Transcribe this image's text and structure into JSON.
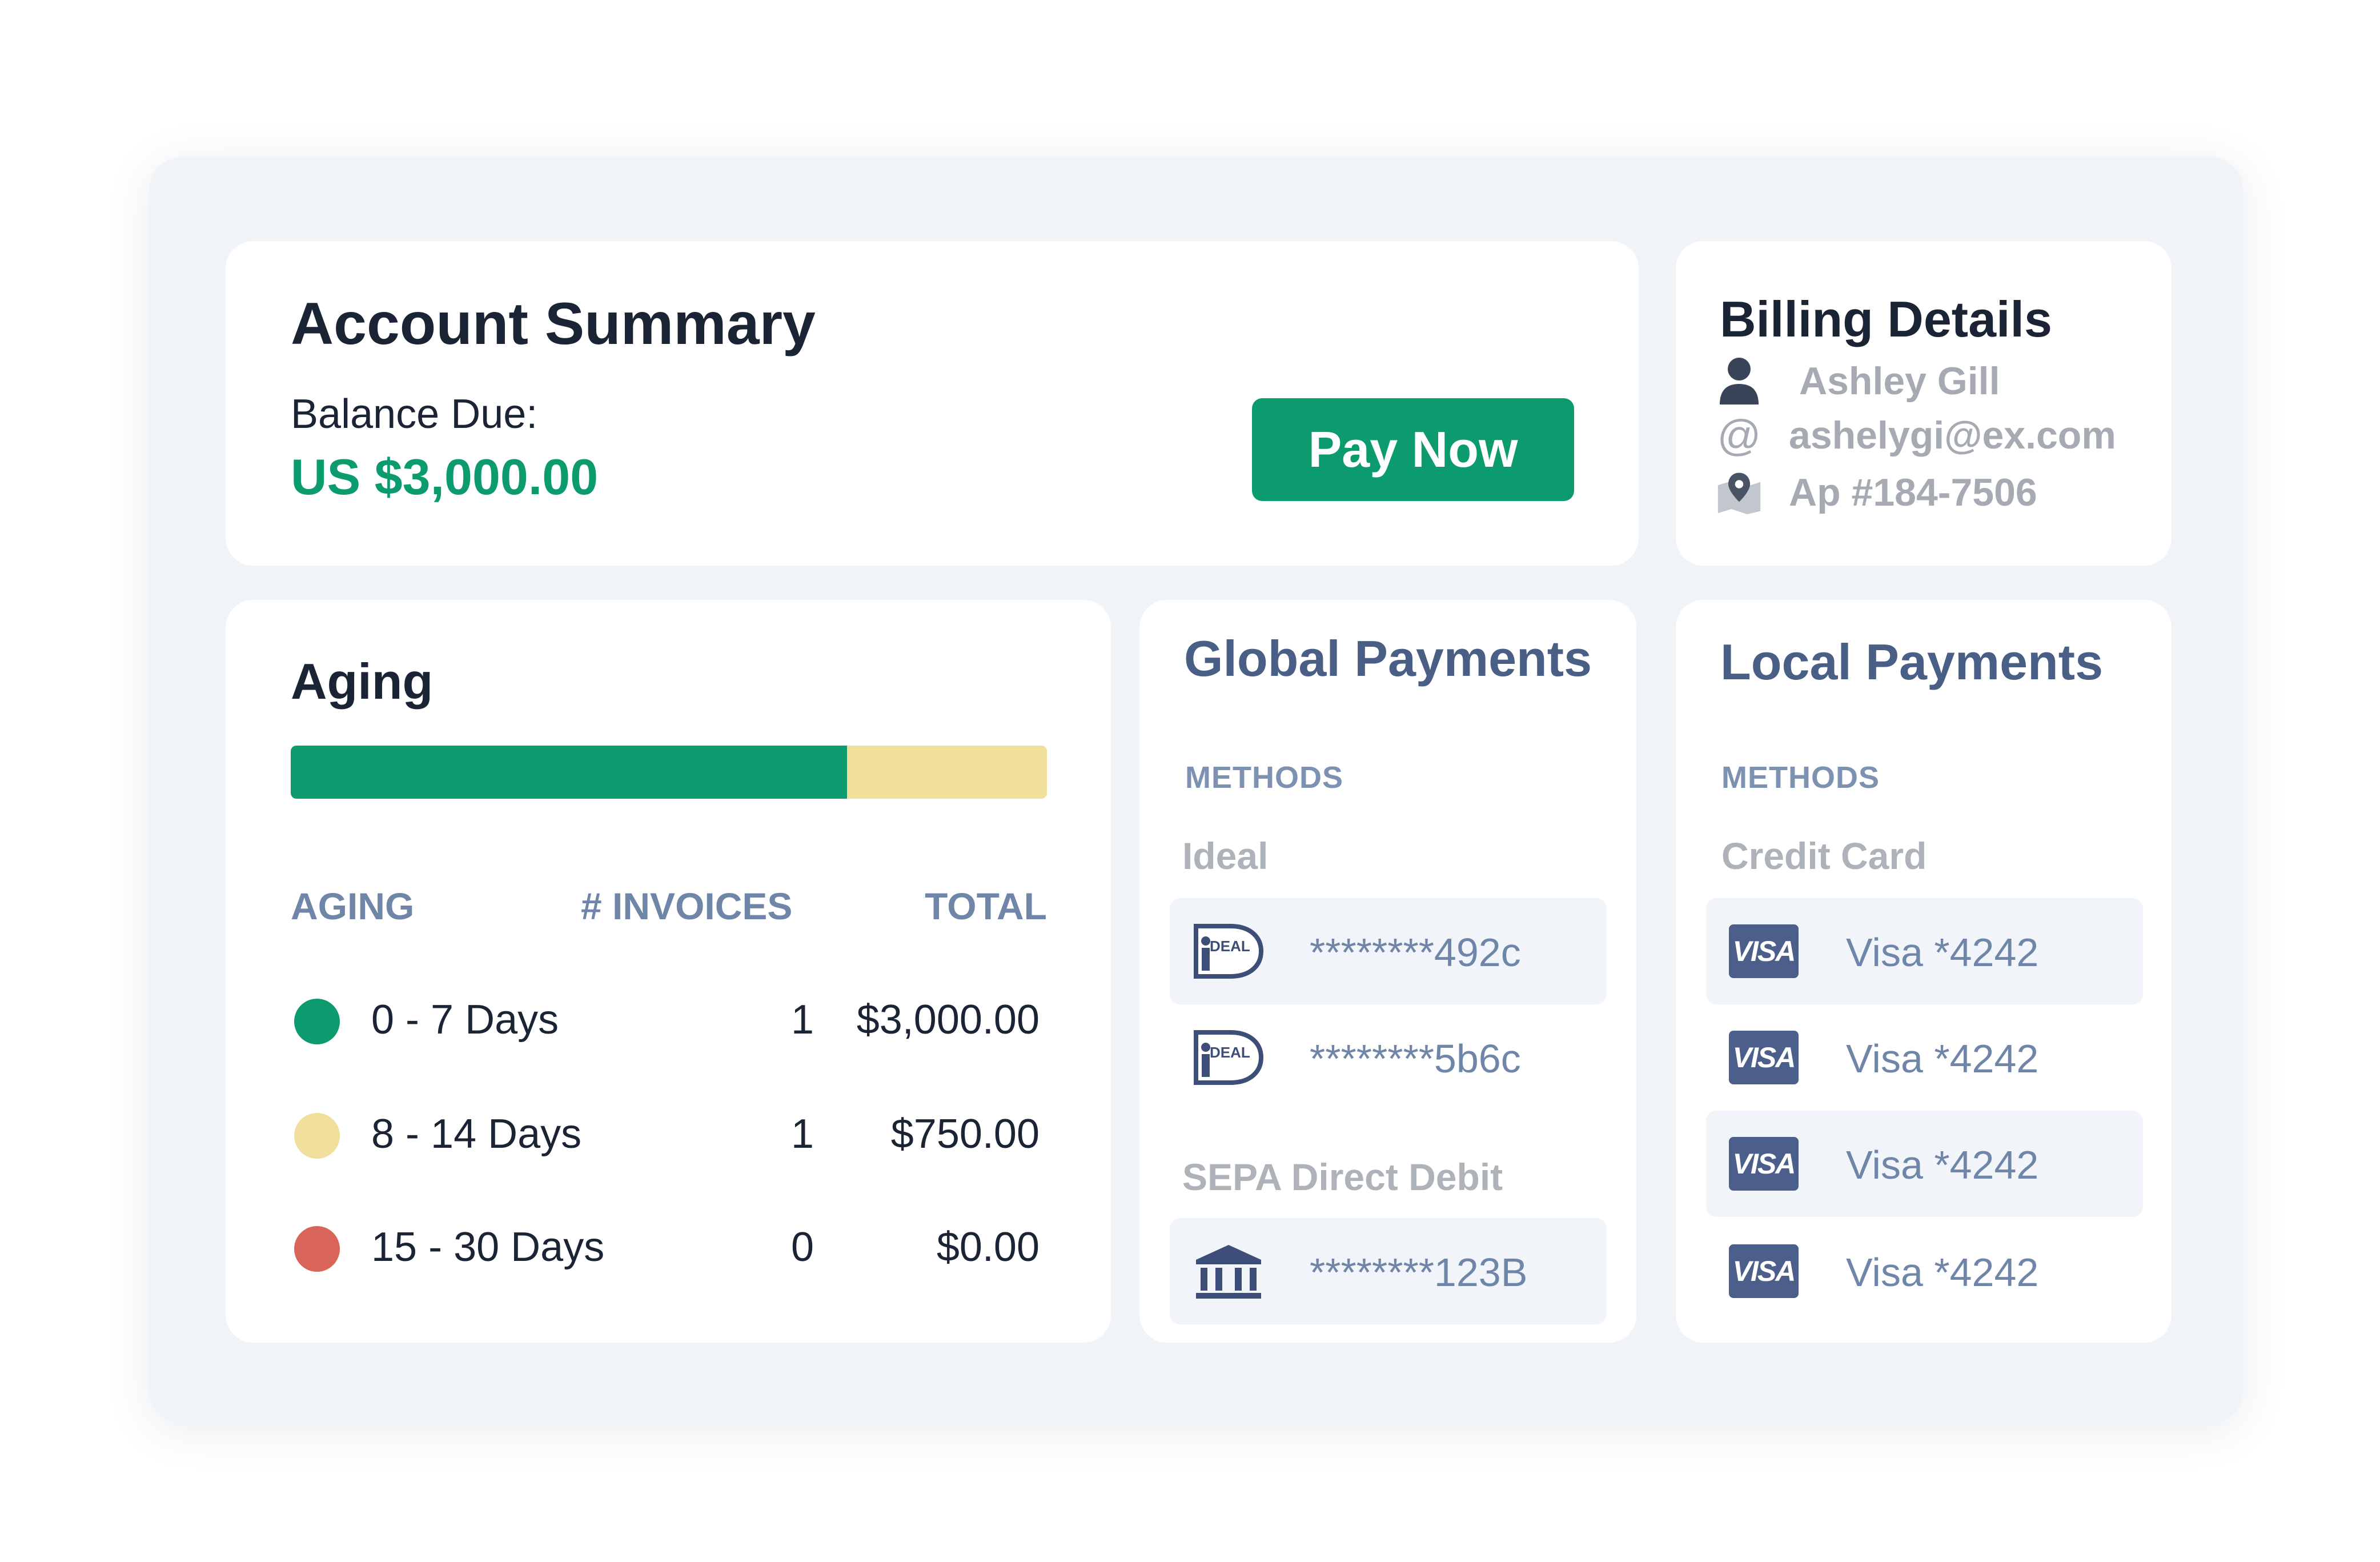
{
  "account_summary": {
    "title": "Account Summary",
    "balance_label": "Balance Due:",
    "balance_value": "US $3,000.00",
    "pay_button": "Pay Now"
  },
  "billing": {
    "title": "Billing Details",
    "name": "Ashley Gill",
    "email": "ashelygi@ex.com",
    "address": "Ap #184-7506",
    "icons": [
      "user-icon",
      "at-icon",
      "map-pin-icon"
    ]
  },
  "aging": {
    "title": "Aging",
    "bar": {
      "green_fraction": 0.736,
      "yellow_fraction": 0.264
    },
    "headers": {
      "aging": "AGING",
      "invoices": "# INVOICES",
      "total": "TOTAL"
    },
    "rows": [
      {
        "range": "0 - 7 Days",
        "count": "1",
        "total": "$3,000.00",
        "color": "#0b9b6e"
      },
      {
        "range": "8 - 14 Days",
        "count": "1",
        "total": "$750.00",
        "color": "#efdf9a"
      },
      {
        "range": "15 - 30 Days",
        "count": "0",
        "total": "$0.00",
        "color": "#d9645a"
      }
    ]
  },
  "global_payments": {
    "title": "Global Payments",
    "methods_label": "METHODS",
    "ideal_label": "Ideal",
    "ideal_items": [
      {
        "masked": "********492c",
        "icon": "ideal-icon"
      },
      {
        "masked": "********5b6c",
        "icon": "ideal-icon"
      }
    ],
    "ideal_logo_text": "DEAL",
    "sepa_label": "SEPA Direct Debit",
    "sepa_items": [
      {
        "masked": "********123B",
        "icon": "bank-icon"
      }
    ]
  },
  "local_payments": {
    "title": "Local Payments",
    "methods_label": "METHODS",
    "credit_label": "Credit Card",
    "card_brand": "VISA",
    "cards": [
      {
        "label": "Visa *4242"
      },
      {
        "label": "Visa *4242"
      },
      {
        "label": "Visa *4242"
      },
      {
        "label": "Visa *4242"
      }
    ]
  },
  "colors": {
    "accent_green": "#0b9b6e",
    "accent_yellow": "#efdf9a",
    "accent_red": "#d9645a",
    "slate_blue": "#4a5f86",
    "panel_bg": "#f0f3f7"
  }
}
